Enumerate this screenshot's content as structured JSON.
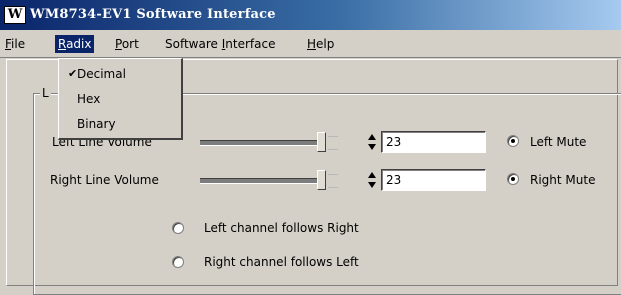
{
  "window": {
    "title": "WM8734-EV1 Software Interface",
    "icon": "wolfson-logo-icon"
  },
  "menubar": {
    "items": [
      {
        "label": "File",
        "mnemonic": "F",
        "rest": "ile"
      },
      {
        "label": "Radix",
        "mnemonic": "R",
        "rest": "adix"
      },
      {
        "label": "Port",
        "mnemonic": "P",
        "rest": "ort"
      },
      {
        "label": "Software Interface",
        "pre": "Software ",
        "mnemonic": "I",
        "rest": "nterface"
      },
      {
        "label": "Help",
        "mnemonic": "H",
        "rest": "elp"
      }
    ]
  },
  "radix_menu": {
    "items": [
      {
        "label": "Decimal",
        "checked": true
      },
      {
        "label": "Hex",
        "checked": false
      },
      {
        "label": "Binary",
        "checked": false
      }
    ],
    "check_mark": "✔"
  },
  "group": {
    "title_fragment": "L"
  },
  "controls": {
    "left_line_volume": {
      "label": "Left Line Volume",
      "value": "23",
      "mute_label": "Left Mute",
      "mute_checked": true
    },
    "right_line_volume": {
      "label": "Right Line Volume",
      "value": "23",
      "mute_label": "Right Mute",
      "mute_checked": true
    },
    "follow_options": [
      {
        "label": "Left channel follows Right",
        "checked": false
      },
      {
        "label": "Right channel follows Left",
        "checked": false
      }
    ]
  },
  "colors": {
    "title_bar": "#0a246a",
    "face": "#d4d0c8",
    "highlight": "#0a246a"
  }
}
